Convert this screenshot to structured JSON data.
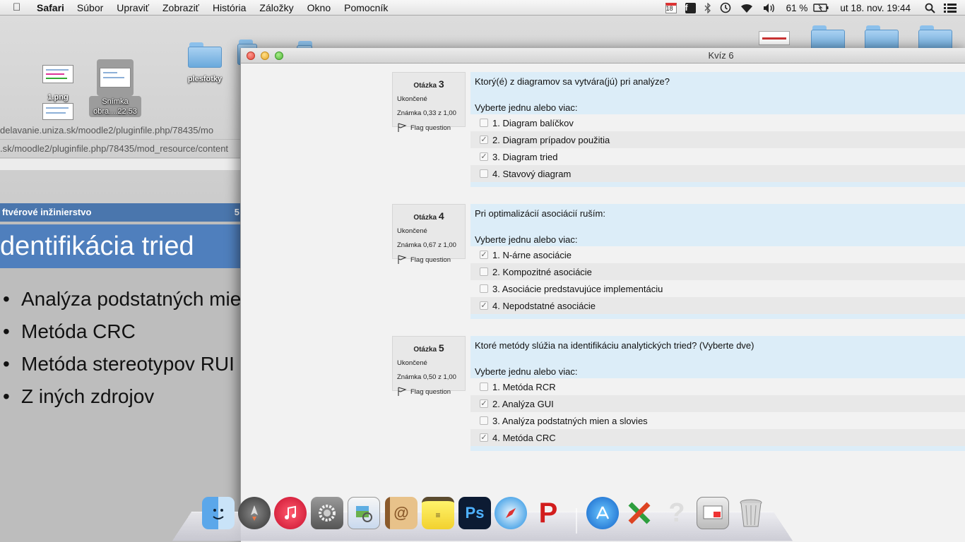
{
  "menubar": {
    "app": "Safari",
    "items": [
      "Súbor",
      "Upraviť",
      "Zobraziť",
      "História",
      "Záložky",
      "Okno",
      "Pomocník"
    ],
    "calendar_day": "18",
    "battery": "61 %",
    "datetime": "ut 18. nov.  19:44"
  },
  "desktop": {
    "items": [
      "plesfotky",
      "1.png",
      "Snímka",
      "obra....22.53"
    ]
  },
  "background_browser": {
    "url1": "delavanie.uniza.sk/moodle2/pluginfile.php/78435/mo",
    "url2": ".sk/moodle2/pluginfile.php/78435/mod_resource/content",
    "slide_header": "ftvérové inžinierstvo",
    "slide_pagenum": "5",
    "slide_title": "dentifikácia tried",
    "bullets": [
      "Analýza podstatných mie",
      "Metóda CRC",
      "Metóda stereotypov RUI",
      "Z iných zdrojov"
    ]
  },
  "window": {
    "title": "Kvíz 6"
  },
  "questions": [
    {
      "label": "Otázka",
      "number": "3",
      "state": "Ukončené",
      "grade": "Známka 0,33 z 1,00",
      "flag": "Flag question",
      "text": "Ktorý(é) z diagramov sa vytvára(jú) pri analýze?",
      "prompt": "Vyberte jednu alebo viac:",
      "answers": [
        {
          "label": "1. Diagram balíčkov",
          "checked": false
        },
        {
          "label": "2. Diagram prípadov použitia",
          "checked": true
        },
        {
          "label": "3. Diagram tried",
          "checked": true
        },
        {
          "label": "4. Stavový diagram",
          "checked": false
        }
      ]
    },
    {
      "label": "Otázka",
      "number": "4",
      "state": "Ukončené",
      "grade": "Známka 0,67 z 1,00",
      "flag": "Flag question",
      "text": "Pri optimalizácií asociácií ruším:",
      "prompt": "Vyberte jednu alebo viac:",
      "answers": [
        {
          "label": "1. N-árne asociácie",
          "checked": true
        },
        {
          "label": "2. Kompozitné asociácie",
          "checked": false
        },
        {
          "label": "3. Asociácie predstavujúce implementáciu",
          "checked": false
        },
        {
          "label": "4. Nepodstatné asociácie",
          "checked": true
        }
      ]
    },
    {
      "label": "Otázka",
      "number": "5",
      "state": "Ukončené",
      "grade": "Známka 0,50 z 1,00",
      "flag": "Flag question",
      "text": "Ktoré metódy slúžia na identifikáciu analytických tried? (Vyberte dve)",
      "prompt": "Vyberte jednu alebo viac:",
      "answers": [
        {
          "label": "1. Metóda RCR",
          "checked": false
        },
        {
          "label": "2. Analýza GUI",
          "checked": true
        },
        {
          "label": "3. Analýza podstatných mien a slovies",
          "checked": false
        },
        {
          "label": "4. Metóda CRC",
          "checked": true
        }
      ]
    }
  ],
  "dock": {
    "icons": [
      "finder-icon",
      "launchpad-icon",
      "itunes-icon",
      "system-preferences-icon",
      "preview-icon",
      "contacts-icon",
      "stickies-icon",
      "photoshop-icon",
      "safari-icon",
      "acrobat-icon",
      "app-store-icon",
      "xcode-icon",
      "help-icon",
      "screenshot-icon",
      "trash-icon"
    ],
    "photoshop_label": "Ps"
  },
  "colors": {
    "question_bg": "#dcedf8",
    "info_bg": "#e8e8e8",
    "slide_blue": "#4f7fbd"
  }
}
